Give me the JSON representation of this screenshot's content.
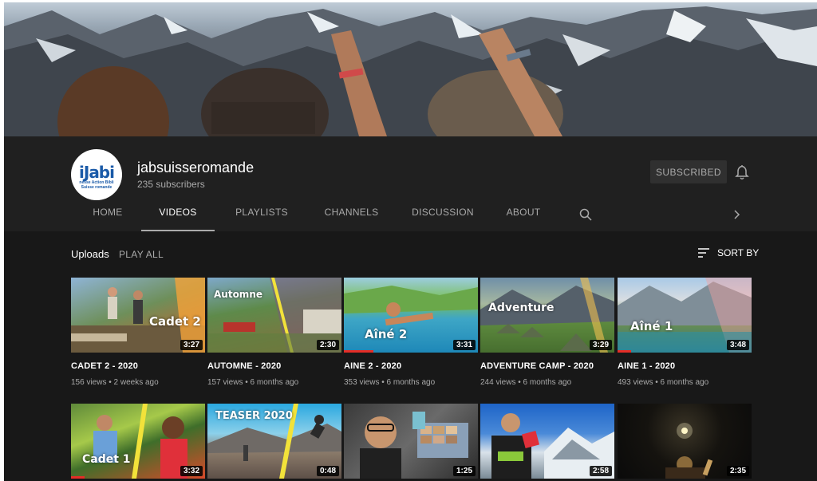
{
  "channel": {
    "name": "jabsuisseromande",
    "subscribers": "235 subscribers",
    "avatar_text": "iJabi",
    "avatar_line1": "nesse Action Bibli",
    "avatar_line2": "Suisse romande",
    "subscribe_label": "SUBSCRIBED"
  },
  "tabs": [
    {
      "label": "HOME",
      "active": false
    },
    {
      "label": "VIDEOS",
      "active": true
    },
    {
      "label": "PLAYLISTS",
      "active": false
    },
    {
      "label": "CHANNELS",
      "active": false
    },
    {
      "label": "DISCUSSION",
      "active": false
    },
    {
      "label": "ABOUT",
      "active": false
    }
  ],
  "section": {
    "title": "Uploads",
    "play_all": "PLAY ALL",
    "sort_by": "SORT BY"
  },
  "videos": [
    {
      "title": "CADET 2 - 2020",
      "views": "156 views",
      "age": "2 weeks ago",
      "duration": "3:27",
      "thumb_text": "Cadet 2",
      "progress": 0
    },
    {
      "title": "AUTOMNE - 2020",
      "views": "157 views",
      "age": "6 months ago",
      "duration": "2:30",
      "thumb_text": "Automne",
      "progress": 0
    },
    {
      "title": "AINE 2 - 2020",
      "views": "353 views",
      "age": "6 months ago",
      "duration": "3:31",
      "thumb_text": "Aîné 2",
      "progress": 0.22
    },
    {
      "title": "ADVENTURE CAMP - 2020",
      "views": "244 views",
      "age": "6 months ago",
      "duration": "3:29",
      "thumb_text": "Adventure",
      "progress": 0
    },
    {
      "title": "AINE 1 - 2020",
      "views": "493 views",
      "age": "6 months ago",
      "duration": "3:48",
      "thumb_text": "Aîné 1",
      "progress": 0.1
    },
    {
      "title": "",
      "views": "",
      "age": "",
      "duration": "3:32",
      "thumb_text": "Cadet 1",
      "progress": 0.1
    },
    {
      "title": "",
      "views": "",
      "age": "",
      "duration": "0:48",
      "thumb_text": "TEASER 2020",
      "progress": 0
    },
    {
      "title": "",
      "views": "",
      "age": "",
      "duration": "1:25",
      "thumb_text": "",
      "progress": 0
    },
    {
      "title": "",
      "views": "",
      "age": "",
      "duration": "2:58",
      "thumb_text": "",
      "progress": 0
    },
    {
      "title": "",
      "views": "",
      "age": "",
      "duration": "2:35",
      "thumb_text": "",
      "progress": 0
    }
  ],
  "colors": {
    "background": "#181818",
    "header": "#202020",
    "accent_red": "#e52d27",
    "muted_text": "#aaaaaa"
  }
}
